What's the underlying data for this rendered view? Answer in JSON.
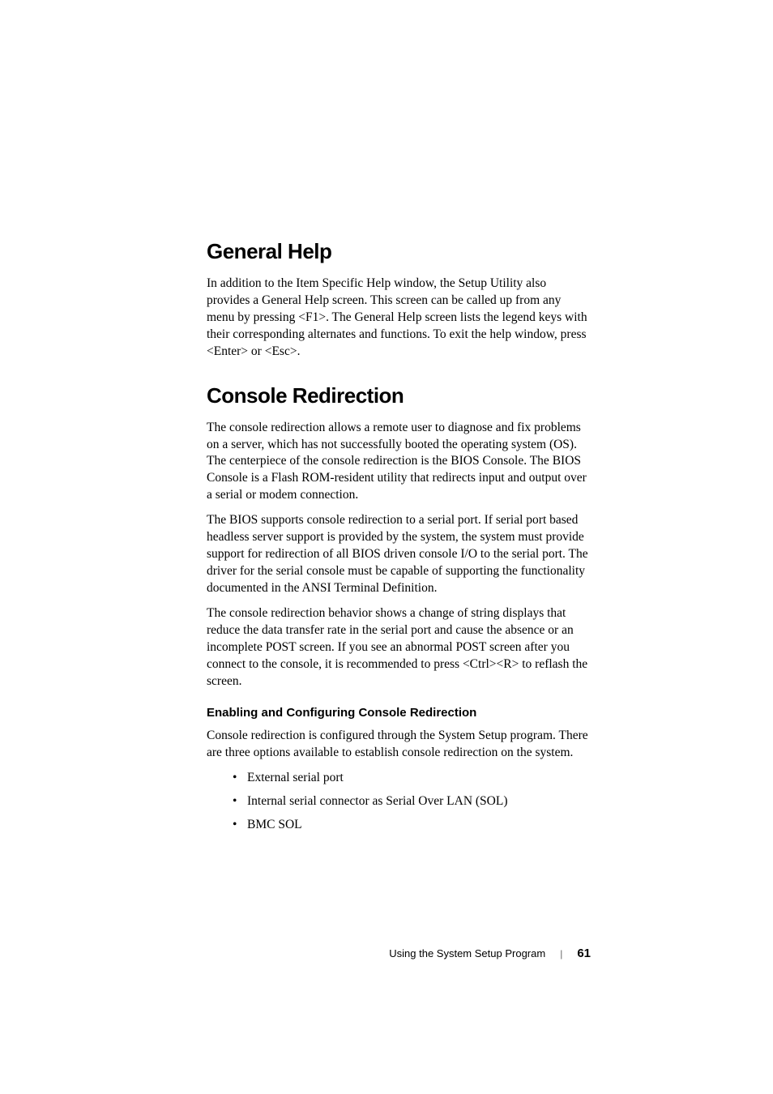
{
  "sections": {
    "generalHelp": {
      "title": "General Help",
      "p1": "In addition to the Item Specific Help window, the Setup Utility also provides a General Help screen. This screen can be called up from any menu by pressing <F1>. The General Help screen lists the legend keys with their corresponding alternates and functions. To exit the help window, press <Enter> or <Esc>."
    },
    "consoleRedirection": {
      "title": "Console Redirection",
      "p1": "The console redirection allows a remote user to diagnose and fix problems on a server, which has not successfully booted the operating system (OS). The centerpiece of the console redirection is the BIOS Console. The BIOS Console is a Flash ROM-resident utility that redirects input and output over a serial or modem connection.",
      "p2": "The BIOS supports console redirection to a serial port. If serial port based headless server support is provided by the system, the system must provide support for redirection of all BIOS driven console I/O to the serial port. The driver for the serial console must be capable of supporting the functionality documented in the ANSI Terminal Definition.",
      "p3": "The console redirection behavior shows a change of string displays that reduce the data transfer rate in the serial port and cause the absence or an incomplete POST screen. If you see an abnormal POST screen after you connect to the console, it is recommended to press <Ctrl><R> to reflash the screen.",
      "subhead": "Enabling and Configuring Console Redirection",
      "p4": "Console redirection is configured through the System Setup program. There are three options available to establish console redirection on the system.",
      "bullets": {
        "b1": "External serial port",
        "b2": "Internal serial connector as Serial Over LAN (SOL)",
        "b3": "BMC SOL"
      }
    }
  },
  "footer": {
    "label": "Using the System Setup Program",
    "pageNum": "61"
  }
}
